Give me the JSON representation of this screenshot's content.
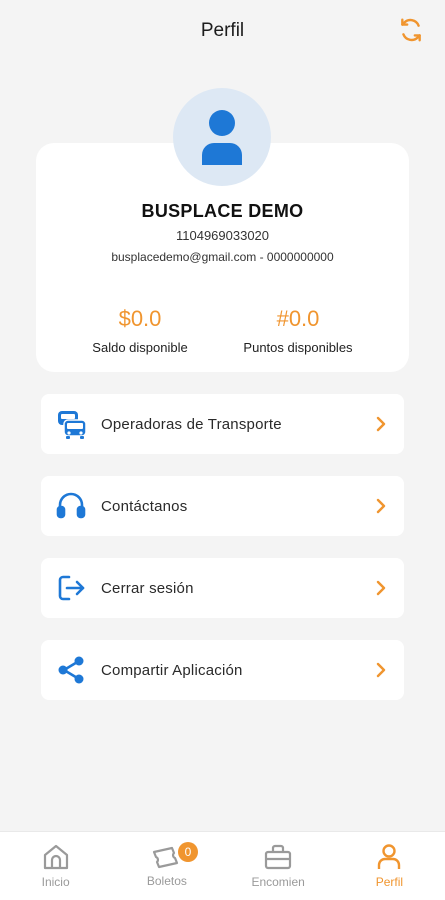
{
  "header": {
    "title": "Perfil",
    "refresh_icon": "refresh-icon"
  },
  "profile": {
    "name": "BUSPLACE DEMO",
    "id_number": "1104969033020",
    "contact": "busplacedemo@gmail.com - 0000000000",
    "balance_value": "$0.0",
    "balance_label": "Saldo disponible",
    "points_value": "#0.0",
    "points_label": "Puntos disponibles"
  },
  "menu": [
    {
      "label": "Operadoras de Transporte",
      "icon": "bus-icon"
    },
    {
      "label": "Contáctanos",
      "icon": "headset-icon"
    },
    {
      "label": "Cerrar sesión",
      "icon": "logout-icon"
    },
    {
      "label": "Compartir Aplicación",
      "icon": "share-icon"
    }
  ],
  "tabbar": [
    {
      "label": "Inicio",
      "icon": "home-icon"
    },
    {
      "label": "Boletos",
      "icon": "ticket-icon",
      "badge": "0"
    },
    {
      "label": "Encomien",
      "icon": "briefcase-icon"
    },
    {
      "label": "Perfil",
      "icon": "user-icon",
      "active": true
    }
  ],
  "colors": {
    "accent": "#f0952f",
    "primary": "#1e78d6",
    "background": "#f4f4f4"
  }
}
